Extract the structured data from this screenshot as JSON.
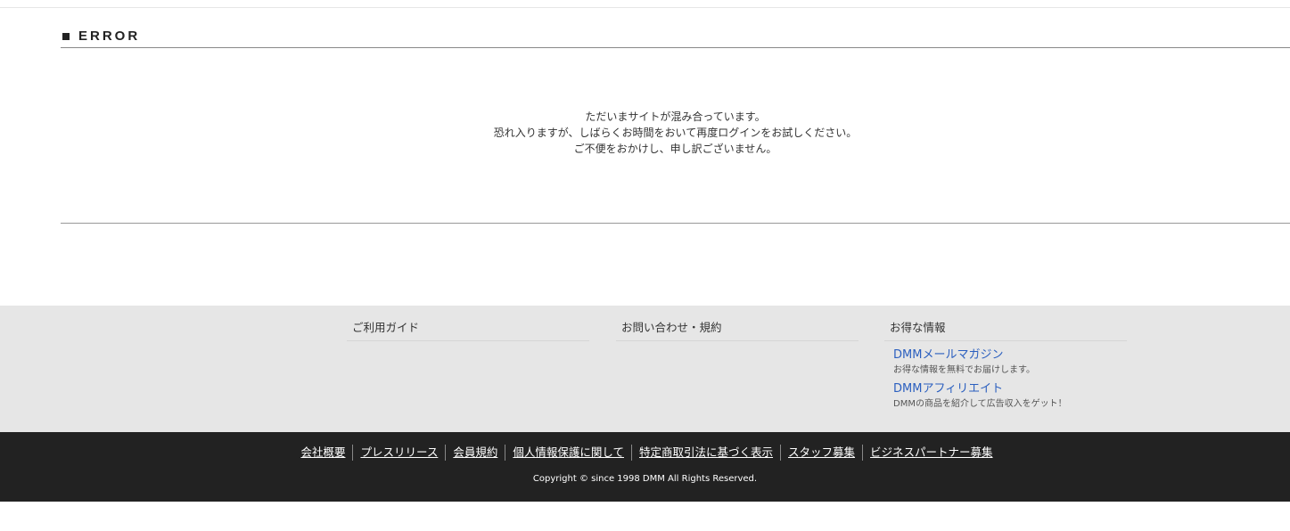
{
  "error": {
    "heading": "ERROR",
    "messages": [
      "ただいまサイトが混み合っています。",
      "恐れ入りますが、しばらくお時間をおいて再度ログインをお試しください。",
      "ご不便をおかけし、申し訳ございません。"
    ]
  },
  "guide": {
    "columns": [
      {
        "title": "ご利用ガイド"
      },
      {
        "title": "お問い合わせ・規約"
      },
      {
        "title": "お得な情報",
        "items": [
          {
            "link": "DMMメールマガジン",
            "desc": "お得な情報を無料でお届けします。"
          },
          {
            "link": "DMMアフィリエイト",
            "desc": "DMMの商品を紹介して広告収入をゲット！"
          }
        ]
      }
    ]
  },
  "footer": {
    "links": [
      "会社概要",
      "プレスリリース",
      "会員規約",
      "個人情報保護に関して",
      "特定商取引法に基づく表示",
      "スタッフ募集",
      "ビジネスパートナー募集"
    ],
    "copyright": "Copyright © since 1998 DMM All Rights Reserved."
  },
  "colors": {
    "link": "#2b5fbf",
    "guide_bg": "#e6e6e6",
    "footer_bg": "#222222"
  }
}
